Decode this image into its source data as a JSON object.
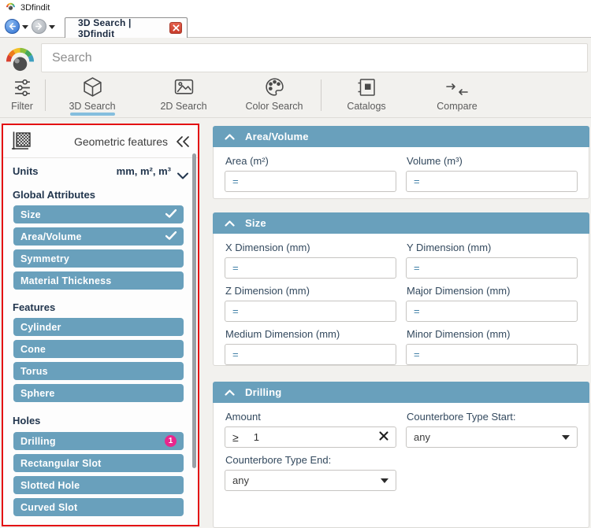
{
  "window": {
    "title": "3Dfindit"
  },
  "nav": {
    "tab_label": "3D Search | 3Dfindit"
  },
  "search": {
    "placeholder": "Search"
  },
  "toolbar": {
    "active": "3D Search",
    "items": [
      {
        "label": "Filter"
      },
      {
        "label": "3D Search"
      },
      {
        "label": "2D Search"
      },
      {
        "label": "Color Search"
      },
      {
        "label": "Catalogs"
      },
      {
        "label": "Compare"
      }
    ]
  },
  "sidebar": {
    "title": "Geometric features",
    "units": {
      "label": "Units",
      "value": "mm, m², m³"
    },
    "sections": [
      {
        "heading": "Global Attributes",
        "buttons": [
          {
            "label": "Size",
            "checked": true
          },
          {
            "label": "Area/Volume",
            "checked": true
          },
          {
            "label": "Symmetry",
            "checked": false
          },
          {
            "label": "Material Thickness",
            "checked": false
          }
        ]
      },
      {
        "heading": "Features",
        "buttons": [
          {
            "label": "Cylinder"
          },
          {
            "label": "Cone"
          },
          {
            "label": "Torus"
          },
          {
            "label": "Sphere"
          }
        ]
      },
      {
        "heading": "Holes",
        "buttons": [
          {
            "label": "Drilling",
            "badge": "1"
          },
          {
            "label": "Rectangular Slot"
          },
          {
            "label": "Slotted Hole"
          },
          {
            "label": "Curved Slot"
          }
        ]
      }
    ]
  },
  "panels": [
    {
      "title": "Area/Volume",
      "fields": [
        {
          "label": "Area (m²)",
          "value": "="
        },
        {
          "label": "Volume (m³)",
          "value": "="
        }
      ]
    },
    {
      "title": "Size",
      "fields": [
        {
          "label": "X Dimension (mm)",
          "value": "="
        },
        {
          "label": "Y Dimension (mm)",
          "value": "="
        },
        {
          "label": "Z Dimension (mm)",
          "value": "="
        },
        {
          "label": "Major Dimension (mm)",
          "value": "="
        },
        {
          "label": "Medium Dimension (mm)",
          "value": "="
        },
        {
          "label": "Minor Dimension (mm)",
          "value": "="
        }
      ]
    },
    {
      "title": "Drilling",
      "fields": [
        {
          "label": "Amount",
          "prefix": "≥",
          "value": "1"
        },
        {
          "label": "Counterbore Type Start:",
          "value": "any"
        },
        {
          "label": "Counterbore Type End:",
          "value": "any"
        }
      ]
    }
  ],
  "colors": {
    "accent_blue": "#69a0bc",
    "badge_pink": "#e9268c",
    "annotation_red": "#e30f13",
    "active_underline": "#85bede"
  }
}
